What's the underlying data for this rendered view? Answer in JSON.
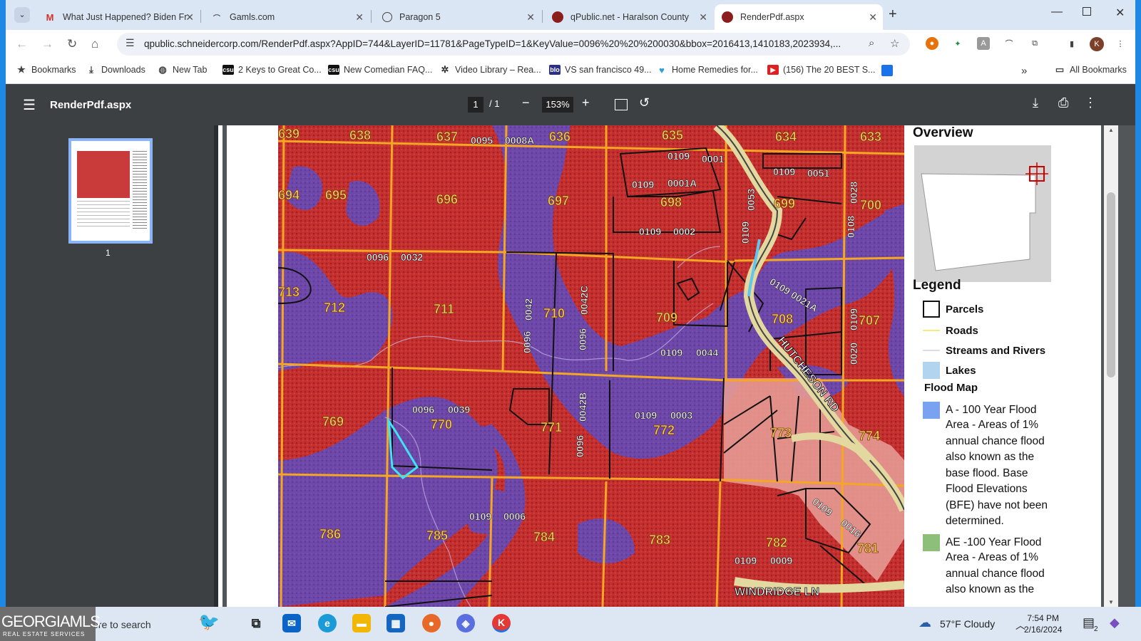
{
  "browser": {
    "tabs": [
      {
        "title": "What Just Happened? Biden Fre",
        "icon": "gmail-icon",
        "active": false
      },
      {
        "title": "Gamls.com",
        "icon": "gamls-icon",
        "active": false
      },
      {
        "title": "Paragon 5",
        "icon": "paragon-icon",
        "active": false
      },
      {
        "title": "qPublic.net - Haralson County",
        "icon": "qpublic-icon",
        "active": false
      },
      {
        "title": "RenderPdf.aspx",
        "icon": "qpublic-icon",
        "active": true
      }
    ],
    "new_tab": "+",
    "url": "qpublic.schneidercorp.com/RenderPdf.aspx?AppID=744&LayerID=11781&PageTypeID=1&KeyValue=0096%20%20%200030&bbox=2016413,1410183,2023934,...",
    "profile_initial": "K"
  },
  "bookmarks": {
    "items": [
      {
        "label": "Bookmarks",
        "icon": "star-icon"
      },
      {
        "label": "Downloads",
        "icon": "download-icon"
      },
      {
        "label": "New Tab",
        "icon": "globe-icon"
      },
      {
        "label": "2 Keys to Great Co...",
        "icon": "csu-icon"
      },
      {
        "label": "New Comedian FAQ...",
        "icon": "csu-icon"
      },
      {
        "label": "Video Library – Rea...",
        "icon": "video-icon"
      },
      {
        "label": "VS san francisco 49...",
        "icon": "blo-icon"
      },
      {
        "label": "Home Remedies for...",
        "icon": "heart-icon"
      },
      {
        "label": "(156) The 20 BEST S...",
        "icon": "youtube-icon"
      }
    ],
    "overflow": "»",
    "all_label": "All Bookmarks"
  },
  "pdf": {
    "filename": "RenderPdf.aspx",
    "page_current": "1",
    "page_total": "/  1",
    "zoom": "153%",
    "thumb_page_label": "1"
  },
  "map": {
    "parcels_yellow": [
      {
        "num": "639"
      },
      {
        "num": "638"
      },
      {
        "num": "637"
      },
      {
        "num": "636"
      },
      {
        "num": "635"
      },
      {
        "num": "634"
      },
      {
        "num": "633"
      },
      {
        "num": "694"
      },
      {
        "num": "695"
      },
      {
        "num": "696"
      },
      {
        "num": "697"
      },
      {
        "num": "698"
      },
      {
        "num": "699"
      },
      {
        "num": "700"
      },
      {
        "num": "713"
      },
      {
        "num": "712"
      },
      {
        "num": "711"
      },
      {
        "num": "710"
      },
      {
        "num": "709"
      },
      {
        "num": "708"
      },
      {
        "num": "707"
      },
      {
        "num": "769"
      },
      {
        "num": "770"
      },
      {
        "num": "771"
      },
      {
        "num": "772"
      },
      {
        "num": "773"
      },
      {
        "num": "774"
      },
      {
        "num": "786"
      },
      {
        "num": "785"
      },
      {
        "num": "784"
      },
      {
        "num": "783"
      },
      {
        "num": "782"
      },
      {
        "num": "781"
      }
    ],
    "ids_white": [
      {
        "text": "0095"
      },
      {
        "text": "0008A"
      },
      {
        "text": "0109"
      },
      {
        "text": "0001"
      },
      {
        "text": "0109"
      },
      {
        "text": "0001A"
      },
      {
        "text": "0109"
      },
      {
        "text": "0051"
      },
      {
        "text": "0109"
      },
      {
        "text": "0002"
      },
      {
        "text": "0096"
      },
      {
        "text": "0032"
      },
      {
        "text": "0109"
      },
      {
        "text": "0044"
      },
      {
        "text": "0096"
      },
      {
        "text": "0039"
      },
      {
        "text": "0109"
      },
      {
        "text": "0003"
      },
      {
        "text": "0109"
      },
      {
        "text": "0006"
      },
      {
        "text": "0109"
      },
      {
        "text": "0009"
      }
    ],
    "ids_vertical": [
      {
        "text": "0053"
      },
      {
        "text": "0109"
      },
      {
        "text": "0028"
      },
      {
        "text": "0108"
      },
      {
        "text": "0042"
      },
      {
        "text": "0096"
      },
      {
        "text": "0042C"
      },
      {
        "text": "0096"
      },
      {
        "text": "0109"
      },
      {
        "text": "0020"
      },
      {
        "text": "0042B"
      },
      {
        "text": "0096"
      }
    ],
    "ids_rotated": [
      {
        "text": "0109  0021A"
      },
      {
        "text": "0109"
      },
      {
        "text": "0016"
      }
    ],
    "roads": {
      "hutcheson": "HUTCHESON RD",
      "windridge": "WINDRIDGE LN"
    }
  },
  "legend_panel": {
    "overview_title": "Overview",
    "legend_title": "Legend",
    "items": [
      {
        "label": "Parcels",
        "color": "#ffffff"
      },
      {
        "label": "Roads",
        "color": "#ffff66"
      },
      {
        "label": "Streams and Rivers",
        "color": "#e8e8f0"
      },
      {
        "label": "Lakes",
        "color": "#b3d4ef"
      }
    ],
    "flood_title": "Flood Map",
    "flood_items": [
      {
        "label": "A - 100 Year Flood",
        "lines": [
          "Area - Areas of 1%",
          "annual chance flood",
          "also known as the",
          "base flood. Base",
          "Flood Elevations",
          "(BFE) have not been",
          "determined."
        ],
        "color": "#79a3f0"
      },
      {
        "label": "AE -100 Year Flood",
        "lines": [
          "Area - Areas of 1%",
          "annual chance flood",
          "also known as the"
        ],
        "color": "#8ebf7a"
      }
    ]
  },
  "taskbar": {
    "logo_main": "GEORGIAMLS",
    "logo_sub": "REAL ESTATE SERVICES",
    "search": "ere to search",
    "weather": "57°F  Cloudy",
    "time": "7:54 PM",
    "date": "2/16/2024",
    "notif_count": "2"
  }
}
